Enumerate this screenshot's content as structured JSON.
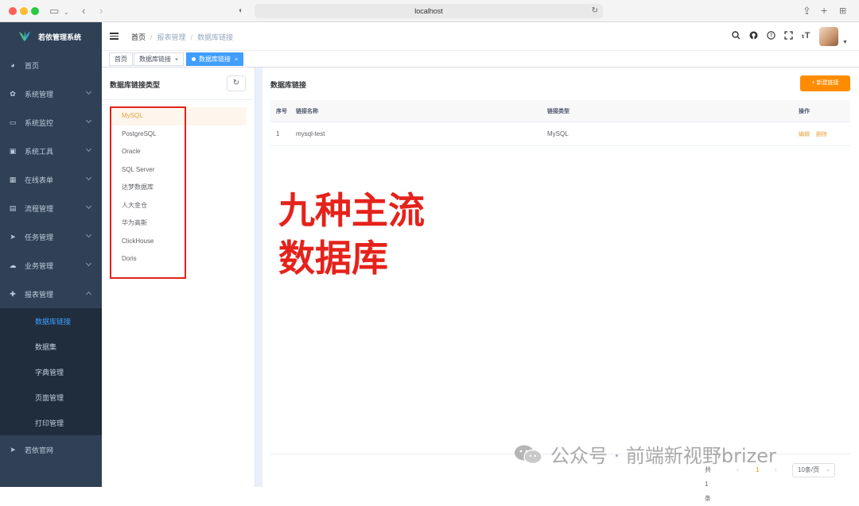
{
  "browser": {
    "url": "localhost"
  },
  "sidebar": {
    "app_title": "若依管理系统",
    "items": [
      {
        "label": "首页",
        "icon": "dashboard-icon",
        "arrow": false
      },
      {
        "label": "系统管理",
        "icon": "gear-icon",
        "arrow": true
      },
      {
        "label": "系统监控",
        "icon": "monitor-icon",
        "arrow": true
      },
      {
        "label": "系统工具",
        "icon": "toolbox-icon",
        "arrow": true
      },
      {
        "label": "在线表单",
        "icon": "table-icon",
        "arrow": true
      },
      {
        "label": "流程管理",
        "icon": "document-icon",
        "arrow": true
      },
      {
        "label": "任务管理",
        "icon": "send-icon",
        "arrow": true
      },
      {
        "label": "业务管理",
        "icon": "cloud-icon",
        "arrow": true
      },
      {
        "label": "报表管理",
        "icon": "plus-cross-icon",
        "arrow": true,
        "expanded": true
      }
    ],
    "submenu": [
      "数据库链接",
      "数据集",
      "字典管理",
      "页面管理",
      "打印管理"
    ],
    "submenu_active": 0,
    "last_item": {
      "label": "若依官网",
      "icon": "send-icon"
    }
  },
  "navbar": {
    "breadcrumb": [
      "首页",
      "报表管理",
      "数据库链接"
    ]
  },
  "tags": [
    {
      "label": "首页"
    },
    {
      "label": "数据库链接",
      "closable": true
    },
    {
      "label": "数据库链接",
      "closable": true,
      "active": true
    }
  ],
  "left_panel": {
    "title": "数据库链接类型",
    "db_types": [
      "MySQL",
      "PostgreSQL",
      "Oracle",
      "SQL Server",
      "达梦数据库",
      "人大金仓",
      "华为高斯",
      "ClickHouse",
      "Doris"
    ],
    "active_index": 0
  },
  "right_panel": {
    "title": "数据库链接",
    "new_button": "新建链接",
    "columns": [
      "序号",
      "链接名称",
      "链接类型",
      "操作"
    ],
    "rows": [
      {
        "index": "1",
        "name": "mysql-test",
        "type": "MySQL",
        "actions": [
          "编辑",
          "删除"
        ]
      }
    ]
  },
  "annotation": {
    "line1": "九种主流",
    "line2": "数据库"
  },
  "pagination": {
    "total": "共 1 条",
    "prev": "‹",
    "page": "1",
    "next": "›",
    "page_size": "10条/页"
  },
  "watermark": "公众号 · 前端新视野brizer",
  "colors": {
    "sidebar_bg": "#304156",
    "accent_blue": "#409eff",
    "accent_orange": "#ff8c00",
    "annotation_red": "#e5221b"
  }
}
